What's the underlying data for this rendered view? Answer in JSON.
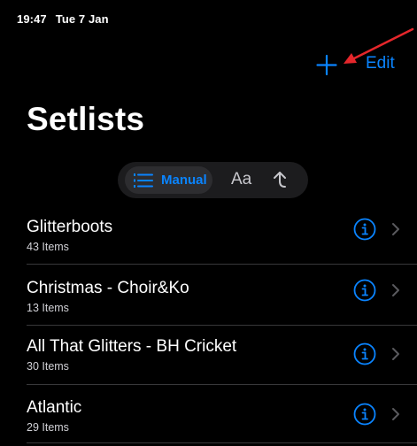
{
  "status_bar": {
    "time": "19:47",
    "date": "Tue 7 Jan"
  },
  "nav": {
    "add_icon": "plus-icon",
    "edit_label": "Edit"
  },
  "page_title": "Setlists",
  "sort_control": {
    "manual_label": "Manual",
    "manual_icon": "list-numbered-icon",
    "alpha_label": "Aa",
    "recent_icon": "arrow-up-icon",
    "selected": "Manual"
  },
  "setlists": [
    {
      "name": "Glitterboots",
      "count": "43 Items"
    },
    {
      "name": "Christmas - Choir&Ko",
      "count": "13 Items"
    },
    {
      "name": "All That Glitters - BH Cricket",
      "count": "30 Items"
    },
    {
      "name": "Atlantic",
      "count": "29 Items"
    }
  ],
  "colors": {
    "accent": "#0a84ff",
    "background": "#000000",
    "annotation_arrow": "#e5262b"
  }
}
